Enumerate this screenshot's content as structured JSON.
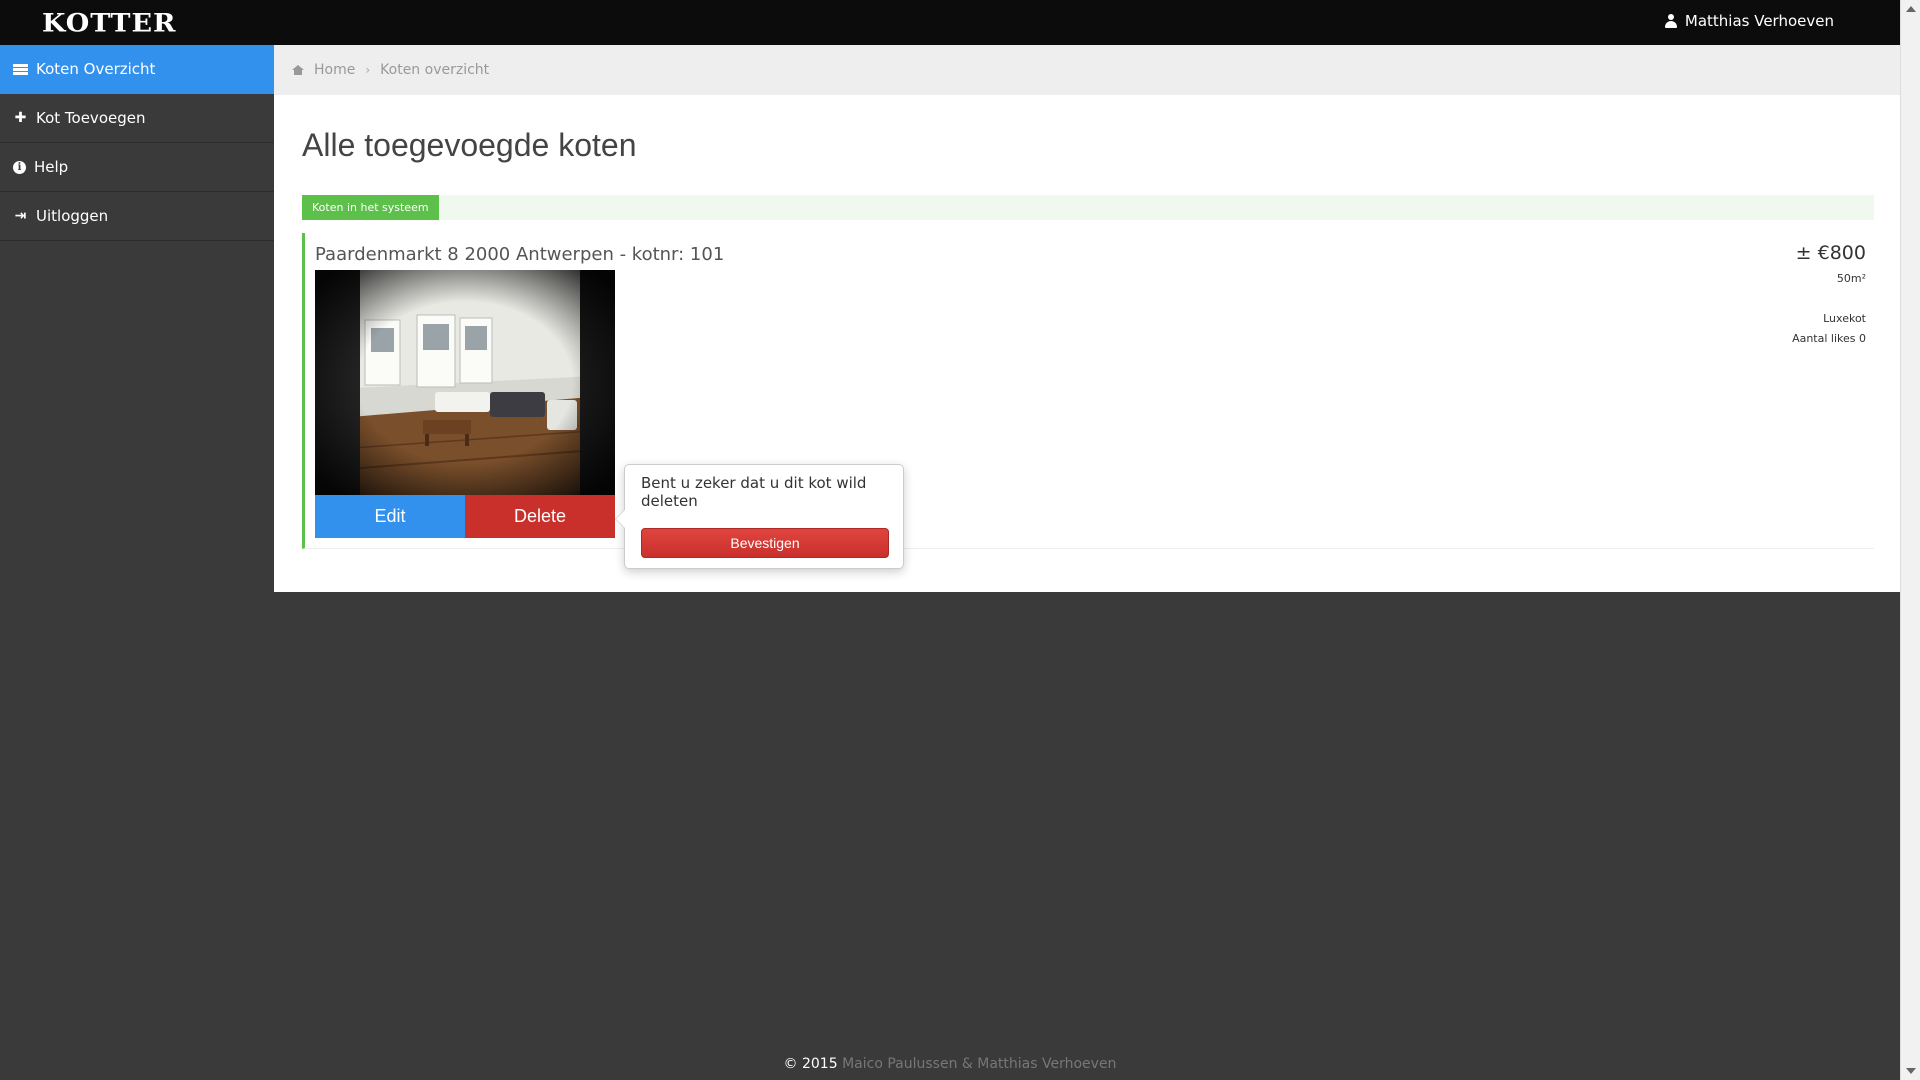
{
  "app": {
    "logo": "KOTTER",
    "user_name": "Matthias Verhoeven"
  },
  "sidebar": {
    "items": [
      {
        "label": "Koten Overzicht",
        "icon": "list-icon",
        "active": true
      },
      {
        "label": "Kot Toevoegen",
        "icon": "plus-icon",
        "active": false
      },
      {
        "label": "Help",
        "icon": "info-icon",
        "active": false
      },
      {
        "label": "Uitloggen",
        "icon": "logout-icon",
        "active": false
      }
    ]
  },
  "breadcrumb": {
    "home": "Home",
    "current": "Koten overzicht"
  },
  "main": {
    "title": "Alle toegevoegde koten",
    "section_label": "Koten in het systeem"
  },
  "kot": {
    "address": "Paardenmarkt 8 2000 Antwerpen - kotnr: 101",
    "price": "± €800",
    "area": "50m²",
    "type": "Luxekot",
    "likes": "Aantal likes 0",
    "edit_label": "Edit",
    "delete_label": "Delete"
  },
  "popover": {
    "text": "Bent u zeker dat u dit kot wild deleten",
    "confirm_label": "Bevestigen"
  },
  "footer": {
    "copyright": "© 2015",
    "names": "Maico Paulussen & Matthias Verhoeven"
  },
  "colors": {
    "accent": "#3391ee",
    "danger": "#c9302c",
    "success": "#5dc04a",
    "topbar": "#0c0c0c",
    "sidebar": "#3a3a3a"
  }
}
